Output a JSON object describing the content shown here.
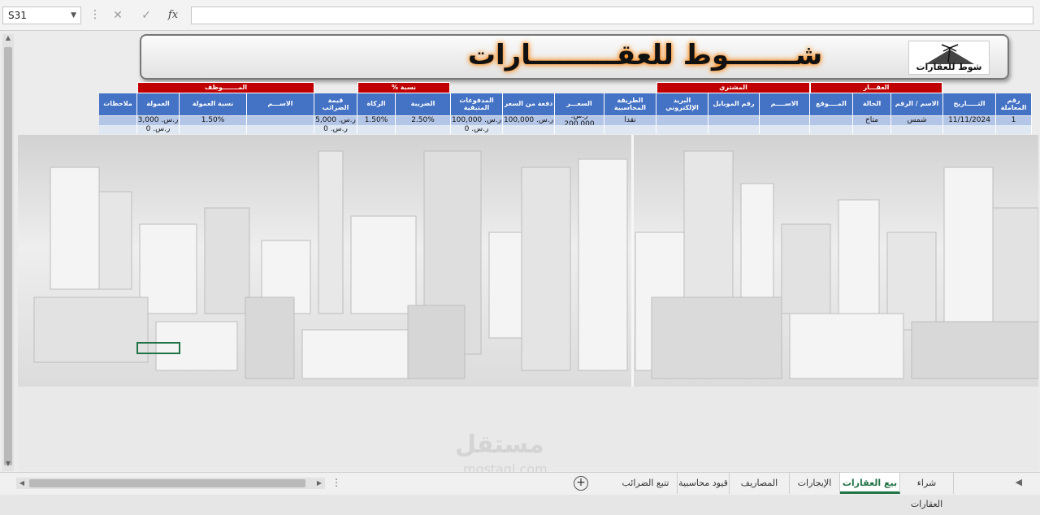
{
  "formula_bar": {
    "name_box": "S31",
    "cancel_icon": "✕",
    "enter_icon": "✓",
    "fx_label": "fx"
  },
  "banner": {
    "title": "شـــــــوط للعقـــــــــارات",
    "logo_text": "شوط للعقارات"
  },
  "group_headers": {
    "employee": "المـــــــوظف",
    "percent": "نسبة %",
    "buyer": "المشتري",
    "property": "العقـــار"
  },
  "columns": [
    "رقم المعاملة",
    "التـــــاريخ",
    "الاسم / الرقم",
    "الحالة",
    "المــــوقع",
    "الاســــم",
    "رقم الموبايل",
    "البريد الإلكتروني",
    "الطريقة المحاسبية",
    "السعـــر",
    "دفعة من السعر",
    "المدفوعات المتبقية",
    "الضريبة",
    "الزكاة",
    "قيمة الضرائب",
    "الاســـم",
    "نسبة العمولة",
    "العمولة",
    "ملاحظات"
  ],
  "rows": [
    {
      "id": "1",
      "date": "11/11/2024",
      "name_no": "شمس",
      "status": "متاح",
      "location": "",
      "buyer_name": "",
      "mobile": "",
      "email": "",
      "method": "نقدا",
      "price": "ر.س. 200,000",
      "down_payment": "ر.س. 100,000",
      "remaining": "ر.س. 100,000",
      "tax": "2.50%",
      "zakat": "1.50%",
      "tax_value": "ر.س. 5,000",
      "employee_name": "",
      "commission_rate": "1.50%",
      "commission": "ر.س. 3,000",
      "notes": ""
    },
    {
      "id": "",
      "date": "",
      "name_no": "",
      "status": "",
      "location": "",
      "buyer_name": "",
      "mobile": "",
      "email": "",
      "method": "",
      "price": "",
      "down_payment": "",
      "remaining": "ر.س. 0",
      "tax": "",
      "zakat": "",
      "tax_value": "ر.س. 0",
      "employee_name": "",
      "commission_rate": "",
      "commission": "ر.س. 0",
      "notes": ""
    }
  ],
  "watermark": {
    "ar": "مستقل",
    "en": "mostaql.com"
  },
  "tabs": [
    {
      "label": "شراء العقارات",
      "active": false
    },
    {
      "label": "بيع العقارات",
      "active": true
    },
    {
      "label": "الإيجارات",
      "active": false
    },
    {
      "label": "المصاريف",
      "active": false
    },
    {
      "label": "قيود محاسبية",
      "active": false
    },
    {
      "label": "تتبع الضرائب",
      "active": false
    }
  ],
  "colors": {
    "group_header": "#c00000",
    "column_header": "#4472c4",
    "row_odd": "#b4c6e7",
    "active_tab": "#217346"
  }
}
